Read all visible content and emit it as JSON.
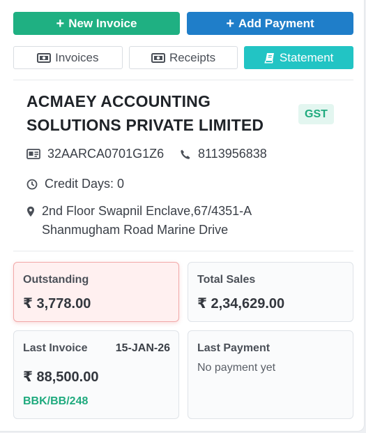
{
  "actions": {
    "new_invoice": "New Invoice",
    "add_payment": "Add Payment"
  },
  "tabs": [
    {
      "label": "Invoices",
      "icon": "money-icon",
      "active": false
    },
    {
      "label": "Receipts",
      "icon": "money-icon",
      "active": false
    },
    {
      "label": "Statement",
      "icon": "book-icon",
      "active": true
    }
  ],
  "customer": {
    "name_line1": "ACMAEY ACCOUNTING",
    "name_line2": "SOLUTIONS PRIVATE LIMITED",
    "badge": "GST",
    "gstin": "32AARCA0701G1Z6",
    "phone": "8113956838",
    "credit_days": "Credit Days: 0",
    "address_line1": "2nd Floor Swapnil Enclave,67/4351-A",
    "address_line2": "Shanmugham Road Marine Drive"
  },
  "summary": {
    "outstanding": {
      "label": "Outstanding",
      "value": "₹ 3,778.00"
    },
    "total_sales": {
      "label": "Total Sales",
      "value": "₹ 2,34,629.00"
    },
    "last_invoice": {
      "label": "Last Invoice",
      "date": "15-JAN-26",
      "value": "₹ 88,500.00",
      "ref": "BBK/BB/248"
    },
    "last_payment": {
      "label": "Last Payment",
      "note": "No payment yet"
    }
  },
  "colors": {
    "green": "#1fb082",
    "blue": "#1f7ec9",
    "teal": "#22c4c4",
    "alert_bg": "#fff0f0",
    "alert_border": "#f1a8a8"
  }
}
